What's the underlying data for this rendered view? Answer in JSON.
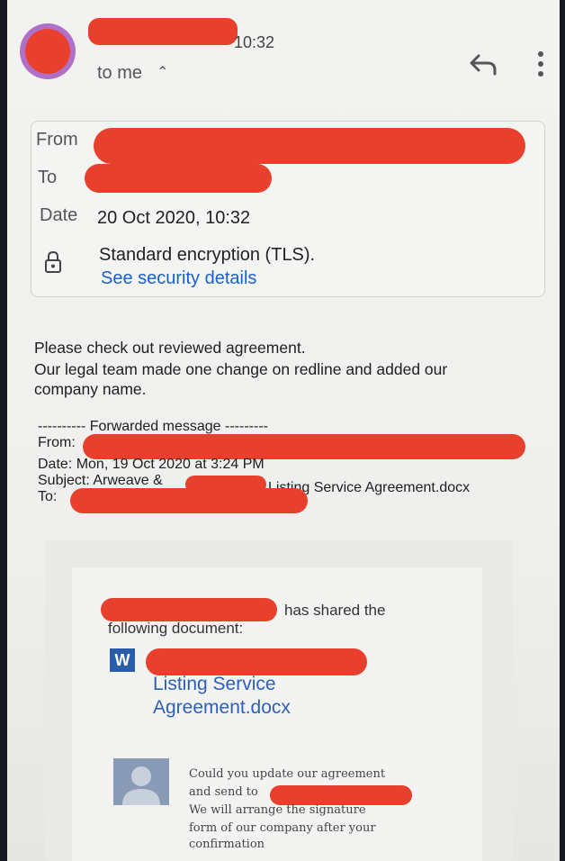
{
  "header": {
    "time": "10:32",
    "recipient_line": "to me",
    "caret": "^"
  },
  "details": {
    "from_label": "From",
    "to_label": "To",
    "date_label": "Date",
    "date_value": "20 Oct 2020, 10:32",
    "encryption": "Standard encryption (TLS).",
    "security_link": "See security details"
  },
  "message": {
    "line1": "Please check out reviewed agreement.",
    "line2": "Our legal team made one change on redline and added our",
    "line3": "company name."
  },
  "forwarded": {
    "header": "---------- Forwarded message ---------",
    "from_label": "From:",
    "date_line": "Date: Mon, 19 Oct 2020 at 3:24 PM",
    "subject_prefix": "Subject: Arweave &",
    "subject_suffix": "Listing Service Agreement.docx",
    "to_label": "To:"
  },
  "shared_card": {
    "shared_suffix": "has shared the",
    "shared_line2": "following document:",
    "doc_icon_letter": "W",
    "doc_title_line1": "Listing Service",
    "doc_title_line2": "Agreement.docx",
    "note_line1": "Could you update our agreement",
    "note_line2": "and send to",
    "note_line3": "We will arrange the signature",
    "note_line4": "form of our company after your",
    "note_line5": "confirmation"
  },
  "colors": {
    "link": "#1a5fd0",
    "redaction": "#e8402c",
    "word_icon": "#2a5caa"
  }
}
